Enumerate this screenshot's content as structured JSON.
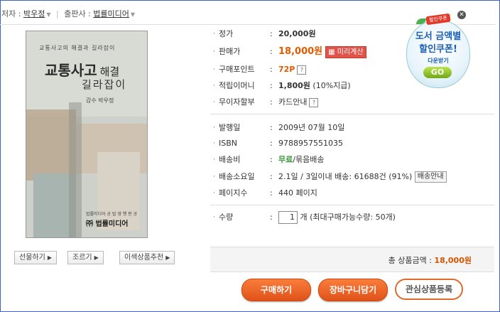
{
  "breadcrumb": {
    "author_label": "저자 :",
    "author": "박우정",
    "publisher_label": "출판사 :",
    "publisher": "법률미디어"
  },
  "cover": {
    "subtitle": "교통사고의 해결과 길라잡이",
    "title_big": "교통사고",
    "title_small": "해결",
    "title_line2": "길라잡이",
    "author": "감수 박우정",
    "publisher_small": "법률미디어 공 법 영 행 판 공",
    "publisher": "㈜ 법률미디어"
  },
  "side_buttons": {
    "gift": "선물하기",
    "poke": "조르기",
    "recommend": "이색상품추천"
  },
  "info": {
    "list_price": {
      "label": "정가",
      "value": "20,000원"
    },
    "sale_price": {
      "label": "판매가",
      "value": "18,000원",
      "calc": "미리계산"
    },
    "points": {
      "label": "구매포인트",
      "value": "72P"
    },
    "money": {
      "label": "적립이머니",
      "value": "1,800원",
      "note": "(10%지급)"
    },
    "installment": {
      "label": "무이자할부",
      "value": "카드안내"
    },
    "pub_date": {
      "label": "발행일",
      "value": "2009년 07월 10일"
    },
    "isbn": {
      "label": "ISBN",
      "value": "9788957551035"
    },
    "shipping": {
      "label": "배송비",
      "free": "무료",
      "bundle": "/묶음배송"
    },
    "delivery": {
      "label": "배송소요일",
      "value": "2.1일 / 3일이내 배송: 61688건 (91%)",
      "button": "배송안내"
    },
    "pages": {
      "label": "페이지수",
      "value": "440 페이지"
    },
    "quantity": {
      "label": "수량",
      "value": "1",
      "note": "개 (최대구매가능수량:  50개)"
    }
  },
  "total": {
    "label": "총 상품금액 :",
    "value": "18,000원"
  },
  "actions": {
    "buy": "구매하기",
    "cart": "장바구니담기",
    "wish": "관심상품등록"
  },
  "coupon": {
    "tag": "할인쿠폰",
    "line1": "도서 금액별",
    "line2": "할인쿠폰!",
    "line3": "다운받기",
    "go": "GO"
  },
  "colors": {
    "accent": "#e05a00",
    "frame": "#3b64c4",
    "button": "#e0521a"
  }
}
